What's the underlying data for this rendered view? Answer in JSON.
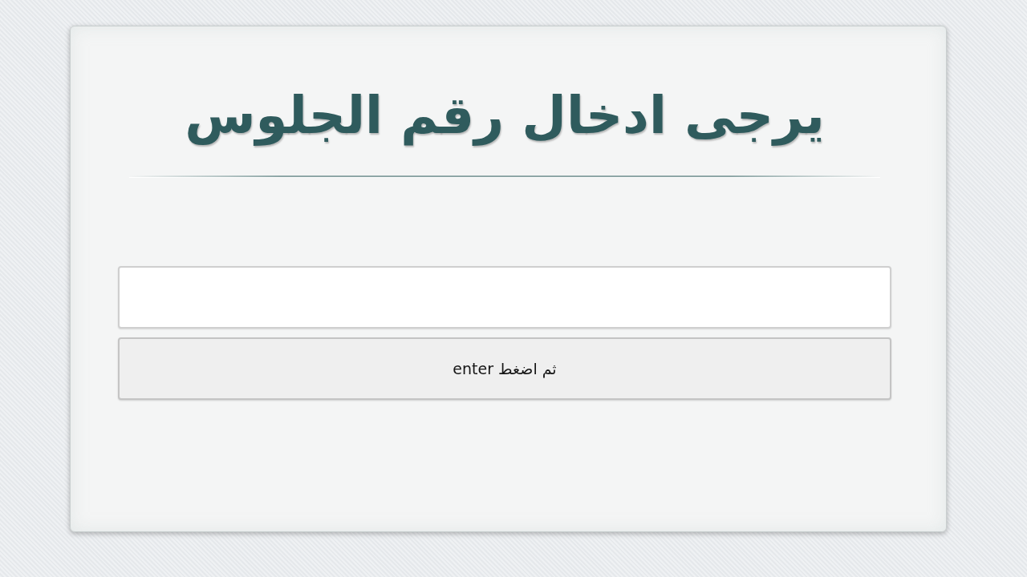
{
  "title": "يرجى ادخال رقم الجلوس",
  "submit_button": {
    "label": "ثم اضغط enter"
  }
}
